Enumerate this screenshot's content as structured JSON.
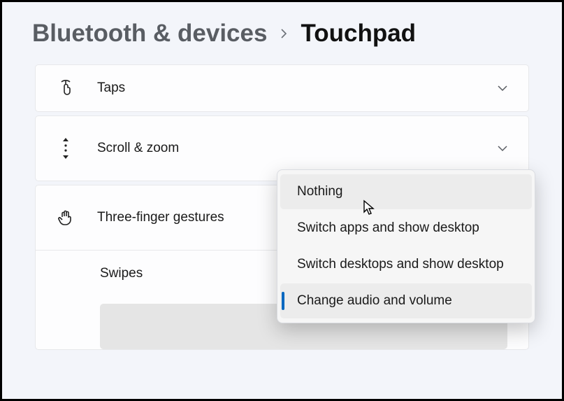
{
  "breadcrumb": {
    "parent": "Bluetooth & devices",
    "current": "Touchpad"
  },
  "panels": {
    "taps": {
      "label": "Taps"
    },
    "scroll": {
      "label": "Scroll & zoom"
    },
    "three_finger": {
      "label": "Three-finger gestures"
    },
    "swipes": {
      "label": "Swipes"
    }
  },
  "dropdown": {
    "options": [
      {
        "label": "Nothing"
      },
      {
        "label": "Switch apps and show desktop"
      },
      {
        "label": "Switch desktops and show desktop"
      },
      {
        "label": "Change audio and volume"
      }
    ],
    "hovered_index": 0,
    "selected_index": 3
  }
}
